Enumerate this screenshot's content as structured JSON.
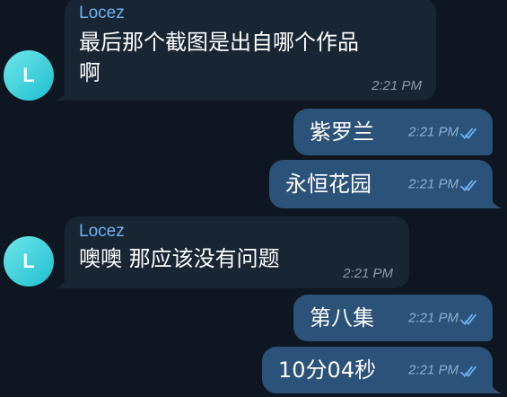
{
  "colors": {
    "background": "#0e1621",
    "incoming_bubble": "#182533",
    "outgoing_bubble": "#2b5278",
    "sender_name": "#6ab3f3",
    "read_ticks": "#6ab3f3",
    "avatar": "#2cc6d4"
  },
  "messages": [
    {
      "direction": "incoming",
      "sender": "Locez",
      "avatar_letter": "L",
      "text": "最后那个截图是出自哪个作品\n啊",
      "time": "2:21 PM"
    },
    {
      "direction": "outgoing",
      "text": "紫罗兰",
      "time": "2:21 PM",
      "status_icon": "double-check-icon"
    },
    {
      "direction": "outgoing",
      "text": "永恒花园",
      "time": "2:21 PM",
      "status_icon": "double-check-icon"
    },
    {
      "direction": "incoming",
      "sender": "Locez",
      "avatar_letter": "L",
      "text": "噢噢 那应该没有问题",
      "time": "2:21 PM"
    },
    {
      "direction": "outgoing",
      "text": "第八集",
      "time": "2:21 PM",
      "status_icon": "double-check-icon"
    },
    {
      "direction": "outgoing",
      "text": "10分04秒",
      "time": "2:21 PM",
      "status_icon": "double-check-icon"
    }
  ]
}
